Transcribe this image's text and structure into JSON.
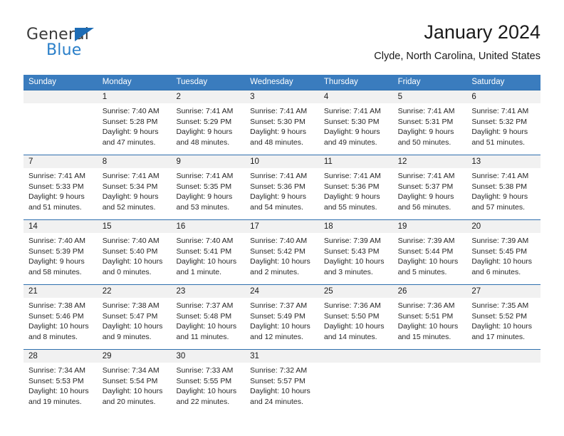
{
  "brand": {
    "logo_text_1": "General",
    "logo_text_2": "Blue",
    "accent_color": "#2a7fc9",
    "triangle_color": "#1d6cb5"
  },
  "header": {
    "title": "January 2024",
    "subtitle": "Clyde, North Carolina, United States"
  },
  "calendar": {
    "header_bg": "#3a7cbe",
    "row_separator_color": "#2f6fae",
    "day_number_bg": "#f1f1f1",
    "weekday_headers": [
      "Sunday",
      "Monday",
      "Tuesday",
      "Wednesday",
      "Thursday",
      "Friday",
      "Saturday"
    ],
    "weeks": [
      {
        "days": [
          {
            "num": "",
            "l1": "",
            "l2": "",
            "l3": "",
            "l4": ""
          },
          {
            "num": "1",
            "l1": "Sunrise: 7:40 AM",
            "l2": "Sunset: 5:28 PM",
            "l3": "Daylight: 9 hours",
            "l4": "and 47 minutes."
          },
          {
            "num": "2",
            "l1": "Sunrise: 7:41 AM",
            "l2": "Sunset: 5:29 PM",
            "l3": "Daylight: 9 hours",
            "l4": "and 48 minutes."
          },
          {
            "num": "3",
            "l1": "Sunrise: 7:41 AM",
            "l2": "Sunset: 5:30 PM",
            "l3": "Daylight: 9 hours",
            "l4": "and 48 minutes."
          },
          {
            "num": "4",
            "l1": "Sunrise: 7:41 AM",
            "l2": "Sunset: 5:30 PM",
            "l3": "Daylight: 9 hours",
            "l4": "and 49 minutes."
          },
          {
            "num": "5",
            "l1": "Sunrise: 7:41 AM",
            "l2": "Sunset: 5:31 PM",
            "l3": "Daylight: 9 hours",
            "l4": "and 50 minutes."
          },
          {
            "num": "6",
            "l1": "Sunrise: 7:41 AM",
            "l2": "Sunset: 5:32 PM",
            "l3": "Daylight: 9 hours",
            "l4": "and 51 minutes."
          }
        ]
      },
      {
        "days": [
          {
            "num": "7",
            "l1": "Sunrise: 7:41 AM",
            "l2": "Sunset: 5:33 PM",
            "l3": "Daylight: 9 hours",
            "l4": "and 51 minutes."
          },
          {
            "num": "8",
            "l1": "Sunrise: 7:41 AM",
            "l2": "Sunset: 5:34 PM",
            "l3": "Daylight: 9 hours",
            "l4": "and 52 minutes."
          },
          {
            "num": "9",
            "l1": "Sunrise: 7:41 AM",
            "l2": "Sunset: 5:35 PM",
            "l3": "Daylight: 9 hours",
            "l4": "and 53 minutes."
          },
          {
            "num": "10",
            "l1": "Sunrise: 7:41 AM",
            "l2": "Sunset: 5:36 PM",
            "l3": "Daylight: 9 hours",
            "l4": "and 54 minutes."
          },
          {
            "num": "11",
            "l1": "Sunrise: 7:41 AM",
            "l2": "Sunset: 5:36 PM",
            "l3": "Daylight: 9 hours",
            "l4": "and 55 minutes."
          },
          {
            "num": "12",
            "l1": "Sunrise: 7:41 AM",
            "l2": "Sunset: 5:37 PM",
            "l3": "Daylight: 9 hours",
            "l4": "and 56 minutes."
          },
          {
            "num": "13",
            "l1": "Sunrise: 7:41 AM",
            "l2": "Sunset: 5:38 PM",
            "l3": "Daylight: 9 hours",
            "l4": "and 57 minutes."
          }
        ]
      },
      {
        "days": [
          {
            "num": "14",
            "l1": "Sunrise: 7:40 AM",
            "l2": "Sunset: 5:39 PM",
            "l3": "Daylight: 9 hours",
            "l4": "and 58 minutes."
          },
          {
            "num": "15",
            "l1": "Sunrise: 7:40 AM",
            "l2": "Sunset: 5:40 PM",
            "l3": "Daylight: 10 hours",
            "l4": "and 0 minutes."
          },
          {
            "num": "16",
            "l1": "Sunrise: 7:40 AM",
            "l2": "Sunset: 5:41 PM",
            "l3": "Daylight: 10 hours",
            "l4": "and 1 minute."
          },
          {
            "num": "17",
            "l1": "Sunrise: 7:40 AM",
            "l2": "Sunset: 5:42 PM",
            "l3": "Daylight: 10 hours",
            "l4": "and 2 minutes."
          },
          {
            "num": "18",
            "l1": "Sunrise: 7:39 AM",
            "l2": "Sunset: 5:43 PM",
            "l3": "Daylight: 10 hours",
            "l4": "and 3 minutes."
          },
          {
            "num": "19",
            "l1": "Sunrise: 7:39 AM",
            "l2": "Sunset: 5:44 PM",
            "l3": "Daylight: 10 hours",
            "l4": "and 5 minutes."
          },
          {
            "num": "20",
            "l1": "Sunrise: 7:39 AM",
            "l2": "Sunset: 5:45 PM",
            "l3": "Daylight: 10 hours",
            "l4": "and 6 minutes."
          }
        ]
      },
      {
        "days": [
          {
            "num": "21",
            "l1": "Sunrise: 7:38 AM",
            "l2": "Sunset: 5:46 PM",
            "l3": "Daylight: 10 hours",
            "l4": "and 8 minutes."
          },
          {
            "num": "22",
            "l1": "Sunrise: 7:38 AM",
            "l2": "Sunset: 5:47 PM",
            "l3": "Daylight: 10 hours",
            "l4": "and 9 minutes."
          },
          {
            "num": "23",
            "l1": "Sunrise: 7:37 AM",
            "l2": "Sunset: 5:48 PM",
            "l3": "Daylight: 10 hours",
            "l4": "and 11 minutes."
          },
          {
            "num": "24",
            "l1": "Sunrise: 7:37 AM",
            "l2": "Sunset: 5:49 PM",
            "l3": "Daylight: 10 hours",
            "l4": "and 12 minutes."
          },
          {
            "num": "25",
            "l1": "Sunrise: 7:36 AM",
            "l2": "Sunset: 5:50 PM",
            "l3": "Daylight: 10 hours",
            "l4": "and 14 minutes."
          },
          {
            "num": "26",
            "l1": "Sunrise: 7:36 AM",
            "l2": "Sunset: 5:51 PM",
            "l3": "Daylight: 10 hours",
            "l4": "and 15 minutes."
          },
          {
            "num": "27",
            "l1": "Sunrise: 7:35 AM",
            "l2": "Sunset: 5:52 PM",
            "l3": "Daylight: 10 hours",
            "l4": "and 17 minutes."
          }
        ]
      },
      {
        "days": [
          {
            "num": "28",
            "l1": "Sunrise: 7:34 AM",
            "l2": "Sunset: 5:53 PM",
            "l3": "Daylight: 10 hours",
            "l4": "and 19 minutes."
          },
          {
            "num": "29",
            "l1": "Sunrise: 7:34 AM",
            "l2": "Sunset: 5:54 PM",
            "l3": "Daylight: 10 hours",
            "l4": "and 20 minutes."
          },
          {
            "num": "30",
            "l1": "Sunrise: 7:33 AM",
            "l2": "Sunset: 5:55 PM",
            "l3": "Daylight: 10 hours",
            "l4": "and 22 minutes."
          },
          {
            "num": "31",
            "l1": "Sunrise: 7:32 AM",
            "l2": "Sunset: 5:57 PM",
            "l3": "Daylight: 10 hours",
            "l4": "and 24 minutes."
          },
          {
            "num": "",
            "l1": "",
            "l2": "",
            "l3": "",
            "l4": ""
          },
          {
            "num": "",
            "l1": "",
            "l2": "",
            "l3": "",
            "l4": ""
          },
          {
            "num": "",
            "l1": "",
            "l2": "",
            "l3": "",
            "l4": ""
          }
        ]
      }
    ]
  }
}
